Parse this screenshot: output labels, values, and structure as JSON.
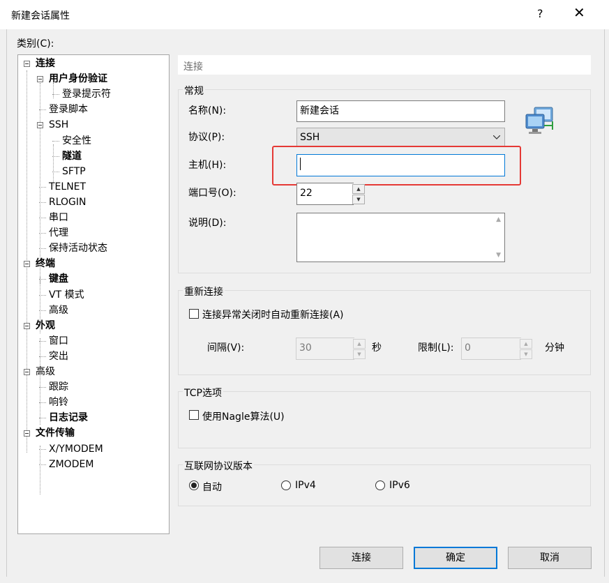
{
  "window": {
    "title": "新建会话属性",
    "help": "?",
    "close": "✕"
  },
  "category_label": "类别(C):",
  "tree": [
    {
      "label": "连接",
      "bold": true
    },
    {
      "label": "用户身份验证",
      "bold": true
    },
    {
      "label": "登录提示符",
      "bold": false
    },
    {
      "label": "登录脚本",
      "bold": false
    },
    {
      "label": "SSH",
      "bold": false
    },
    {
      "label": "安全性",
      "bold": false
    },
    {
      "label": "隧道",
      "bold": true
    },
    {
      "label": "SFTP",
      "bold": false
    },
    {
      "label": "TELNET",
      "bold": false
    },
    {
      "label": "RLOGIN",
      "bold": false
    },
    {
      "label": "串口",
      "bold": false
    },
    {
      "label": "代理",
      "bold": false
    },
    {
      "label": "保持活动状态",
      "bold": false
    },
    {
      "label": "终端",
      "bold": true
    },
    {
      "label": "键盘",
      "bold": true
    },
    {
      "label": "VT 模式",
      "bold": false
    },
    {
      "label": "高级",
      "bold": false
    },
    {
      "label": "外观",
      "bold": true
    },
    {
      "label": "窗口",
      "bold": false
    },
    {
      "label": "突出",
      "bold": false
    },
    {
      "label": "高级",
      "bold": false
    },
    {
      "label": "跟踪",
      "bold": false
    },
    {
      "label": "响铃",
      "bold": false
    },
    {
      "label": "日志记录",
      "bold": true
    },
    {
      "label": "文件传输",
      "bold": true
    },
    {
      "label": "X/YMODEM",
      "bold": false
    },
    {
      "label": "ZMODEM",
      "bold": false
    }
  ],
  "section_header": "连接",
  "general": {
    "title": "常规",
    "name_label": "名称(N):",
    "name_value": "新建会话",
    "protocol_label": "协议(P):",
    "protocol_value": "SSH",
    "host_label": "主机(H):",
    "host_value": "",
    "port_label": "端口号(O):",
    "port_value": "22",
    "desc_label": "说明(D):"
  },
  "reconnect": {
    "title": "重新连接",
    "checkbox_label": "连接异常关闭时自动重新连接(A)",
    "interval_label": "间隔(V):",
    "interval_value": "30",
    "interval_unit": "秒",
    "limit_label": "限制(L):",
    "limit_value": "0",
    "limit_unit": "分钟"
  },
  "tcp": {
    "title": "TCP选项",
    "nagle_label": "使用Nagle算法(U)"
  },
  "ipver": {
    "title": "互联网协议版本",
    "auto": "自动",
    "ipv4": "IPv4",
    "ipv6": "IPv6",
    "selected": "自动"
  },
  "buttons": {
    "connect": "连接",
    "ok": "确定",
    "cancel": "取消"
  }
}
